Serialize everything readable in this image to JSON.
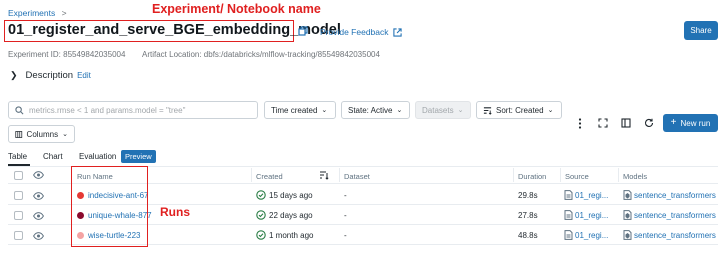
{
  "annotations": {
    "notebook_label": "Experiment/ Notebook name",
    "runs_label": "Runs"
  },
  "breadcrumb": {
    "parent": "Experiments",
    "separator": ">"
  },
  "header": {
    "title": "01_register_and_serve_BGE_embedding_model",
    "feedback": "Provide Feedback",
    "share": "Share",
    "experiment_id": "Experiment ID: 85549842035004",
    "artifact_location": "Artifact Location: dbfs:/databricks/mlflow-tracking/85549842035004"
  },
  "description": {
    "label": "Description",
    "edit": "Edit"
  },
  "toolbar": {
    "search_placeholder": "metrics.rmse < 1 and params.model = \"tree\"",
    "time_created": "Time created",
    "state": "State: Active",
    "datasets": "Datasets",
    "sort": "Sort: Created",
    "columns": "Columns",
    "new_run": "New run"
  },
  "tabs": [
    {
      "label": "Table"
    },
    {
      "label": "Chart"
    },
    {
      "label": "Evaluation"
    }
  ],
  "preview_badge": "Preview",
  "table": {
    "headers": {
      "run_name": "Run Name",
      "created": "Created",
      "dataset": "Dataset",
      "duration": "Duration",
      "source": "Source",
      "models": "Models"
    },
    "rows": [
      {
        "name": "indecisive-ant-67",
        "color": "#e53935",
        "created": "15 days ago",
        "dataset": "-",
        "duration": "29.8s",
        "source": "01_regi...",
        "model": "sentence_transformers"
      },
      {
        "name": "unique-whale-877",
        "color": "#8b0b2e",
        "created": "22 days ago",
        "dataset": "-",
        "duration": "27.8s",
        "source": "01_regi...",
        "model": "sentence_transformers"
      },
      {
        "name": "wise-turtle-223",
        "color": "#f4a3a3",
        "created": "1 month ago",
        "dataset": "-",
        "duration": "48.8s",
        "source": "01_regi...",
        "model": "sentence_transformers"
      }
    ]
  },
  "colors": {
    "accent": "#2272b4",
    "annotation": "#e02020"
  }
}
